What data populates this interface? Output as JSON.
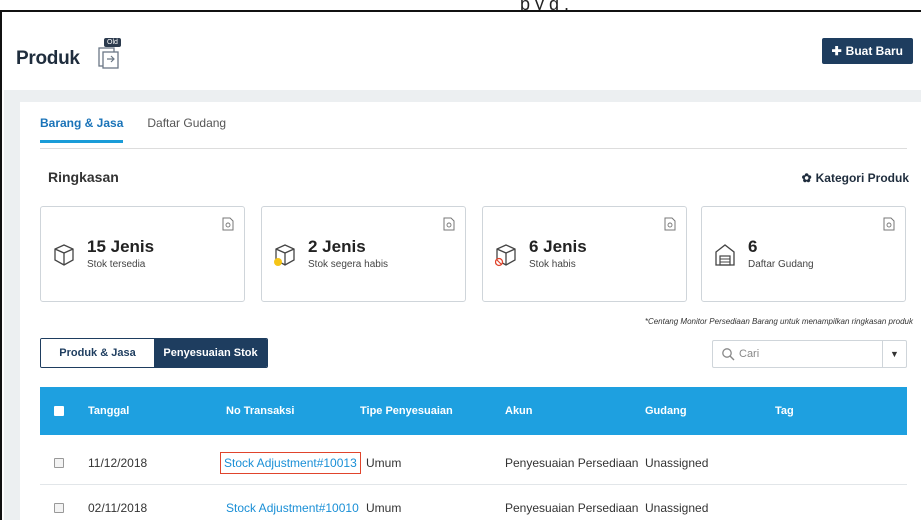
{
  "header": {
    "top_partial_text": "p    y   g      ,",
    "title": "Produk",
    "old_badge": "Old",
    "new_button": "Buat Baru"
  },
  "tabs": [
    {
      "label": "Barang & Jasa",
      "active": true
    },
    {
      "label": "Daftar Gudang",
      "active": false
    }
  ],
  "summary": {
    "title": "Ringkasan",
    "category_link": "Kategori Produk",
    "cards": [
      {
        "number": "15 Jenis",
        "label": "Stok tersedia",
        "icon": "box-icon"
      },
      {
        "number": "2 Jenis",
        "label": "Stok segera habis",
        "icon": "box-warning-icon"
      },
      {
        "number": "6 Jenis",
        "label": "Stok habis",
        "icon": "box-empty-icon"
      },
      {
        "number": "6",
        "label": "Daftar Gudang",
        "icon": "warehouse-icon"
      }
    ],
    "note": "*Centang Monitor Persediaan Barang untuk menampilkan ringkasan produk"
  },
  "segment": {
    "option1": "Produk & Jasa",
    "option2": "Penyesuaian Stok",
    "selected": "Penyesuaian Stok"
  },
  "search": {
    "placeholder": "Cari"
  },
  "table": {
    "headers": [
      "Tanggal",
      "No Transaksi",
      "Tipe Penyesuaian",
      "Akun",
      "Gudang",
      "Tag"
    ],
    "rows": [
      {
        "date": "11/12/2018",
        "transaction": "Stock Adjustment#10013",
        "type": "Umum",
        "account": "Penyesuaian Persediaan",
        "warehouse": "Unassigned",
        "tag": ""
      },
      {
        "date": "02/11/2018",
        "transaction": "Stock Adjustment#10010",
        "type": "Umum",
        "account": "Penyesuaian Persediaan",
        "warehouse": "Unassigned",
        "tag": ""
      }
    ]
  },
  "colors": {
    "primary_dark": "#1e3d5f",
    "header_blue": "#1ea0e0",
    "link_blue": "#1a8fd6",
    "highlight_red": "#e0442c"
  }
}
